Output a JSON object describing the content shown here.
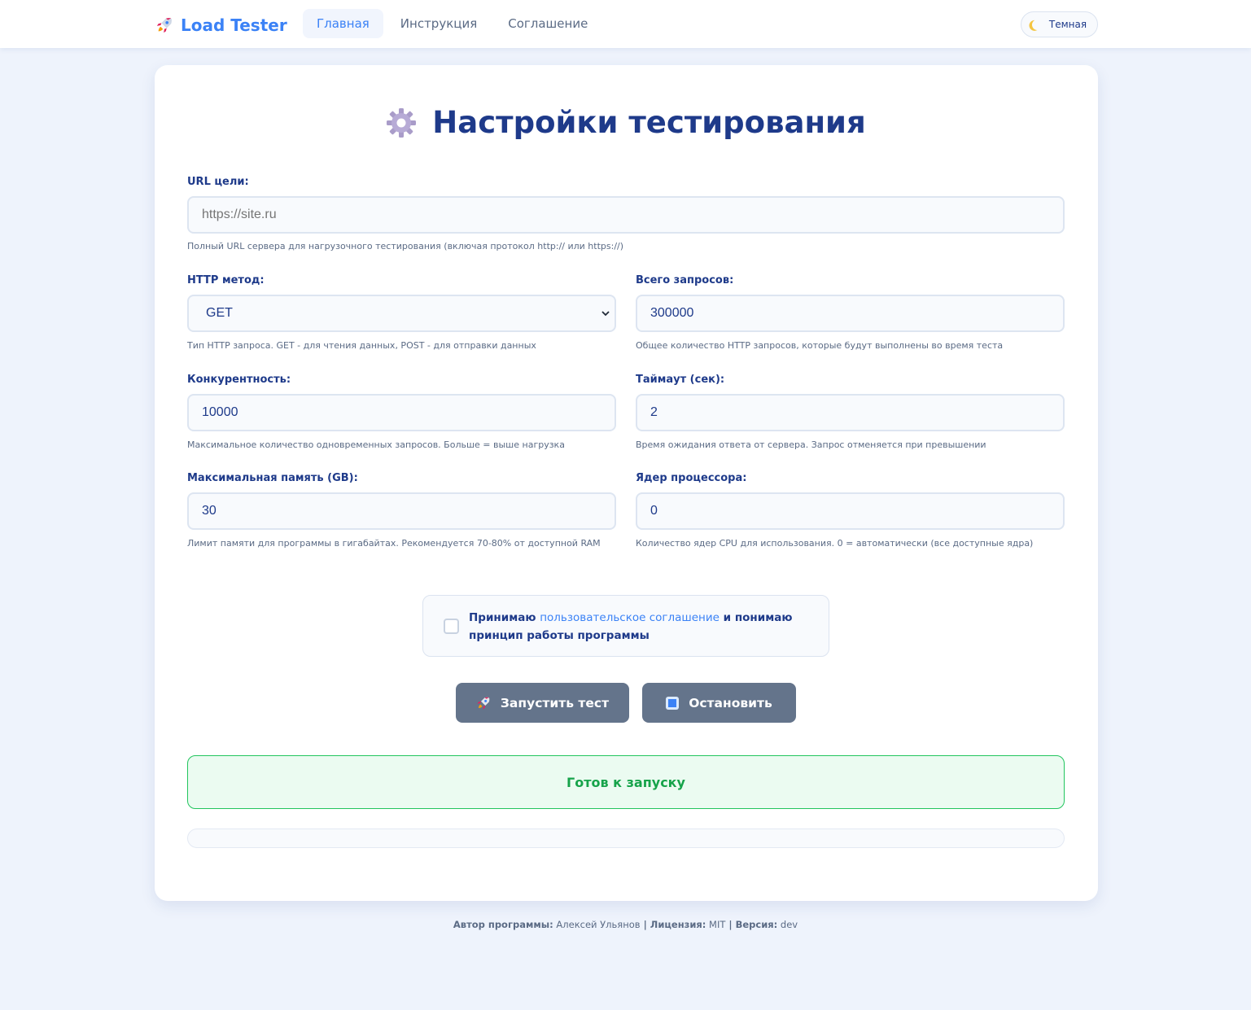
{
  "app": {
    "brand": "Load Tester",
    "nav": [
      {
        "label": "Главная",
        "active": true
      },
      {
        "label": "Инструкция",
        "active": false
      },
      {
        "label": "Соглашение",
        "active": false
      }
    ],
    "theme_toggle": "Темная"
  },
  "page": {
    "title": "Настройки тестирования",
    "title_icon": "gear-icon"
  },
  "form": {
    "url": {
      "label": "URL цели:",
      "placeholder": "https://site.ru",
      "value": "",
      "hint": "Полный URL сервера для нагрузочного тестирования (включая протокол http:// или https://)"
    },
    "method": {
      "label": "HTTP метод:",
      "value": "GET",
      "hint": "Тип HTTP запроса. GET - для чтения данных, POST - для отправки данных"
    },
    "total_requests": {
      "label": "Всего запросов:",
      "value": "300000",
      "hint": "Общее количество HTTP запросов, которые будут выполнены во время теста"
    },
    "concurrency": {
      "label": "Конкурентность:",
      "value": "10000",
      "hint": "Максимальное количество одновременных запросов. Больше = выше нагрузка"
    },
    "timeout": {
      "label": "Таймаут (сек):",
      "value": "2",
      "hint": "Время ожидания ответа от сервера. Запрос отменяется при превышении"
    },
    "max_memory": {
      "label": "Максимальная память (GB):",
      "value": "30",
      "hint": "Лимит памяти для программы в гигабайтах. Рекомендуется 70-80% от доступной RAM"
    },
    "cpu_cores": {
      "label": "Ядер процессора:",
      "value": "0",
      "hint": "Количество ядер CPU для использования. 0 = автоматически (все доступные ядра)"
    }
  },
  "agreement": {
    "checked": false,
    "prefix": "Принимаю ",
    "link": "пользовательское соглашение",
    "suffix_line1": " и понимаю",
    "suffix_line2": "принцип работы программы"
  },
  "actions": {
    "start": "Запустить тест",
    "stop": "Остановить"
  },
  "status": {
    "text": "Готов к запуску",
    "progress_fraction": 0
  },
  "footer": {
    "author_label": "Автор программы:",
    "author": "Алексей Ульянов",
    "sep": " | ",
    "license_label": "Лицензия:",
    "license": "MIT",
    "version_label": "Версия:",
    "version": "dev"
  },
  "colors": {
    "accent": "#3b82f6",
    "title": "#1e3a8a",
    "button": "#64748b",
    "status_green": "#16a34a",
    "background": "#eef3fc"
  }
}
